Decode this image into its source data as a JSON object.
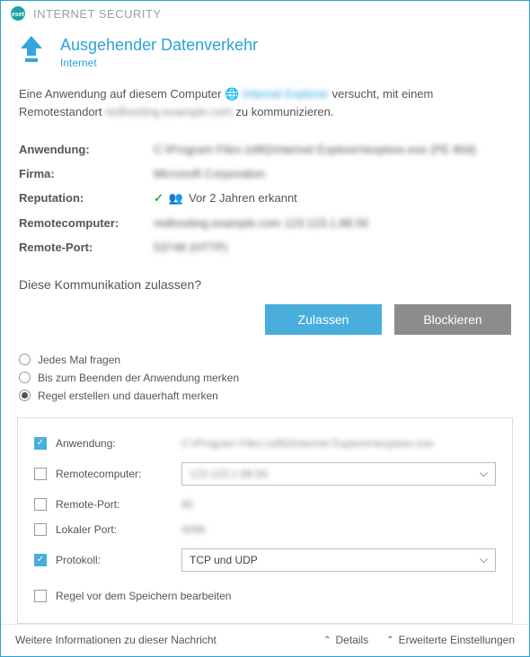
{
  "titlebar": {
    "product": "INTERNET SECURITY"
  },
  "header": {
    "title": "Ausgehender Datenverkehr",
    "subtitle": "Internet"
  },
  "intro": {
    "p1": "Eine Anwendung auf diesem Computer",
    "app_blur": "Internet Explorer",
    "p2": "versucht, mit einem Remotestandort",
    "host_blur": "redhosting.example.com",
    "p3": "zu kommunizieren."
  },
  "details": {
    "anwendung_label": "Anwendung:",
    "anwendung_value": "C:\\Program Files (x86)\\Internet Explorer\\iexplore.exe (PE 80d)",
    "firma_label": "Firma:",
    "firma_value": "Microsoft Corporation",
    "reputation_label": "Reputation:",
    "reputation_text": "Vor 2 Jahren erkannt",
    "remotecomputer_label": "Remotecomputer:",
    "remotecomputer_value": "redhosting.example.com 123.123.1.88.56",
    "remoteport_label": "Remote-Port:",
    "remoteport_value": "53748 (HTTP)"
  },
  "question": "Diese Kommunikation zulassen?",
  "buttons": {
    "allow": "Zulassen",
    "block": "Blockieren"
  },
  "radios": {
    "r1": "Jedes Mal fragen",
    "r2": "Bis zum Beenden der Anwendung merken",
    "r3": "Regel erstellen und dauerhaft merken"
  },
  "rule": {
    "anwendung_label": "Anwendung:",
    "anwendung_value": "C:\\Program Files (x86)\\Internet Explorer\\iexplore.exe",
    "remotecomputer_label": "Remotecomputer:",
    "remotecomputer_value": "123.123.1.88.56",
    "remoteport_label": "Remote-Port:",
    "remoteport_value": "80",
    "lokalerport_label": "Lokaler Port:",
    "lokalerport_value": "4096",
    "protokoll_label": "Protokoll:",
    "protokoll_value": "TCP und UDP",
    "edit_label": "Regel vor dem Speichern bearbeiten"
  },
  "bottom": {
    "info": "Weitere Informationen zu dieser Nachricht",
    "details": "Details",
    "advanced": "Erweiterte Einstellungen"
  }
}
